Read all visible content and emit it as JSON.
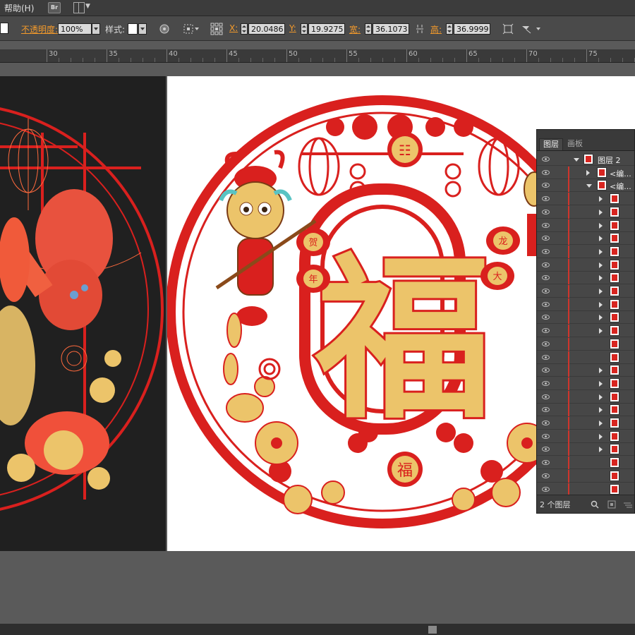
{
  "menubar": {
    "help_label": "帮助(H)",
    "bridge_label": "Br"
  },
  "control_bar": {
    "opacity_label": "不透明度:",
    "opacity_value": "100%",
    "style_label": "样式:",
    "x_label": "X:",
    "x_value": "20.0486",
    "y_label": "Y:",
    "y_value": "19.9275",
    "width_label": "宽:",
    "width_value": "36.1073",
    "height_label": "高:",
    "height_value": "36.9999"
  },
  "ruler": {
    "ticks": [
      "30",
      "35",
      "40",
      "45",
      "50",
      "55",
      "60",
      "65",
      "70",
      "75"
    ]
  },
  "artwork": {
    "main_char": "福",
    "badge_char": "福",
    "lantern_chars": [
      "贺",
      "龙",
      "年",
      "大"
    ]
  },
  "layers_panel": {
    "tabs": [
      "图层",
      "画板"
    ],
    "layer_name": "图层 2",
    "sublayer_1": "<编...",
    "sublayer_2": "<编...",
    "layer_count": "2 个图层"
  },
  "colors": {
    "paper_red": "#d9201e",
    "gold": "#ecc46a",
    "canvas_bg": "#5a5a5a",
    "panel_bg": "#474747"
  }
}
